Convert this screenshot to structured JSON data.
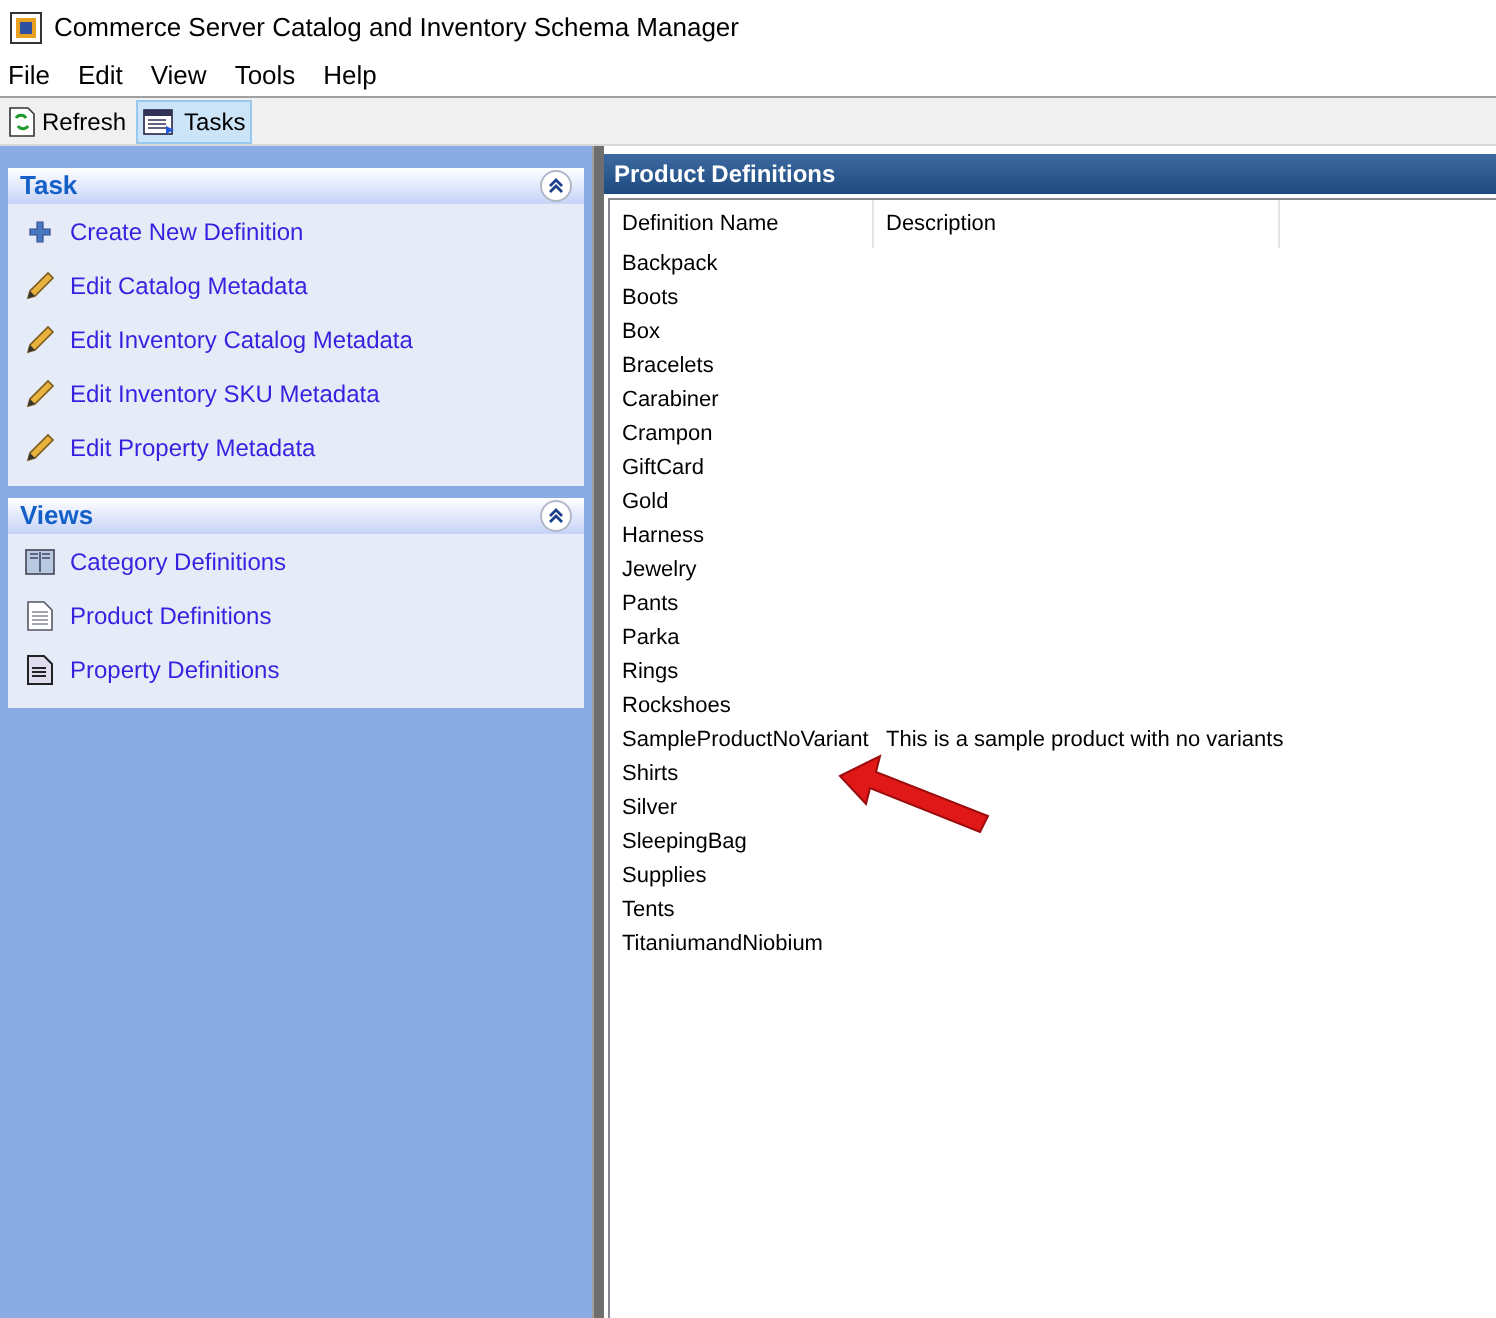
{
  "window": {
    "title": "Commerce Server Catalog and Inventory Schema Manager"
  },
  "menu": [
    "File",
    "Edit",
    "View",
    "Tools",
    "Help"
  ],
  "toolbar": [
    {
      "label": "Refresh",
      "kind": "refresh",
      "selected": false
    },
    {
      "label": "Tasks",
      "kind": "tasks",
      "selected": true
    }
  ],
  "sidebar": [
    {
      "title": "Task",
      "items": [
        {
          "label": "Create New Definition",
          "kind": "plus"
        },
        {
          "label": "Edit Catalog Metadata",
          "kind": "pencil"
        },
        {
          "label": "Edit Inventory Catalog Metadata",
          "kind": "pencil"
        },
        {
          "label": "Edit Inventory SKU Metadata",
          "kind": "pencil"
        },
        {
          "label": "Edit Property Metadata",
          "kind": "pencil"
        }
      ]
    },
    {
      "title": "Views",
      "items": [
        {
          "label": "Category Definitions",
          "kind": "book"
        },
        {
          "label": "Product Definitions",
          "kind": "page"
        },
        {
          "label": "Property Definitions",
          "kind": "doc"
        }
      ]
    }
  ],
  "content": {
    "title": "Product Definitions",
    "table": {
      "columns": [
        "Definition Name",
        "Description"
      ],
      "rows": [
        [
          "Backpack"
        ],
        [
          "Boots"
        ],
        [
          "Box"
        ],
        [
          "Bracelets"
        ],
        [
          "Carabiner"
        ],
        [
          "Crampon"
        ],
        [
          "GiftCard"
        ],
        [
          "Gold"
        ],
        [
          "Harness"
        ],
        [
          "Jewelry"
        ],
        [
          "Pants"
        ],
        [
          "Parka"
        ],
        [
          "Rings"
        ],
        [
          "Rockshoes"
        ],
        [
          "SampleProductNoVariant",
          "This is a sample product with no variants"
        ],
        [
          "Shirts"
        ],
        [
          "Silver"
        ],
        [
          "SleepingBag"
        ],
        [
          "Supplies"
        ],
        [
          "Tents"
        ],
        [
          "TitaniumandNiobium"
        ]
      ]
    }
  }
}
